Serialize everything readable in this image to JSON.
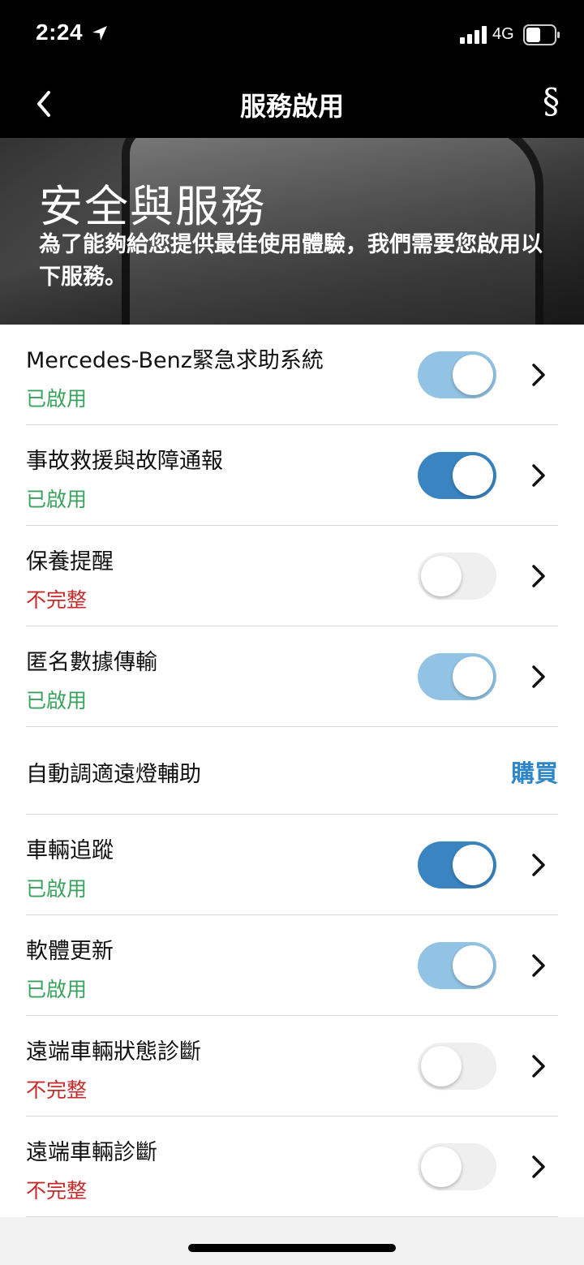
{
  "status_bar": {
    "time": "2:24",
    "network": "4G",
    "location_icon": "location-arrow-icon",
    "signal_icon": "cellular-signal-icon",
    "battery_icon": "battery-icon"
  },
  "nav": {
    "back_icon": "chevron-left-icon",
    "title": "服務啟用",
    "legal_label": "§"
  },
  "hero": {
    "title": "安全與服務",
    "subtitle": "為了能夠給您提供最佳使用體驗，我們需要您啟用以下服務。"
  },
  "colors": {
    "enabled_status": "#3aa25c",
    "incomplete_status": "#c62b2b",
    "toggle_on_light": "#92c3e4",
    "toggle_on_dark": "#3a84c2",
    "toggle_off": "#efefef",
    "buy_link": "#2f86c6"
  },
  "services": [
    {
      "title": "Mercedes-Benz緊急求助系統",
      "status": "已啟用",
      "toggle": "on"
    },
    {
      "title": "事故救援與故障通報",
      "status": "已啟用",
      "toggle": "on"
    },
    {
      "title": "保養提醒",
      "status": "不完整",
      "toggle": "off"
    },
    {
      "title": "匿名數據傳輸",
      "status": "已啟用",
      "toggle": "on"
    },
    {
      "title": "自動調適遠燈輔助",
      "action": "購買"
    },
    {
      "title": "車輛追蹤",
      "status": "已啟用",
      "toggle": "on"
    },
    {
      "title": "軟體更新",
      "status": "已啟用",
      "toggle": "on"
    },
    {
      "title": "遠端車輛狀態診斷",
      "status": "不完整",
      "toggle": "off"
    },
    {
      "title": "遠端車輛診斷",
      "status": "不完整",
      "toggle": "off"
    }
  ]
}
